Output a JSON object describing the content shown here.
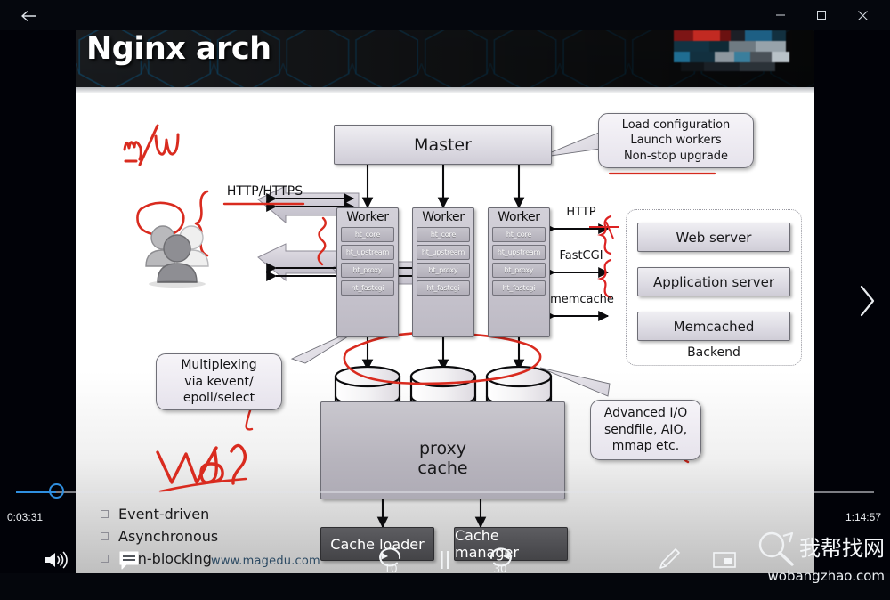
{
  "window": {
    "back_label": "←",
    "minimize_label": "—",
    "maximize_label": "□",
    "close_label": "✕"
  },
  "slide": {
    "title": "Nginx arch",
    "footer_url": "www.magedu.com",
    "master": "Master",
    "master_callout": [
      "Load configuration",
      "Launch workers",
      "Non-stop upgrade"
    ],
    "client_label": "HTTP/HTTPS",
    "workers": [
      {
        "title": "Worker",
        "modules": [
          "ht_core",
          "ht_upstream",
          "ht_proxy",
          "ht_fastcgi"
        ]
      },
      {
        "title": "Worker",
        "modules": [
          "ht_core",
          "ht_upstream",
          "ht_proxy",
          "ht_fastcgi"
        ]
      },
      {
        "title": "Worker",
        "modules": [
          "ht_core",
          "ht_upstream",
          "ht_proxy",
          "ht_fastcgi"
        ]
      }
    ],
    "protocols": [
      "HTTP",
      "FastCGI",
      "memcache"
    ],
    "backend": {
      "title": "Backend",
      "services": [
        "Web server",
        "Application server",
        "Memcached"
      ]
    },
    "multiplexing_callout": [
      "Multiplexing",
      "via kevent/",
      "epoll/select"
    ],
    "advanced_io_callout": [
      "Advanced I/O",
      "sendfile, AIO,",
      "mmap etc."
    ],
    "cache": {
      "label_line1": "proxy",
      "label_line2": "cache",
      "loader": "Cache loader",
      "manager": "Cache manager"
    },
    "bullets": [
      "Event-driven",
      "Asynchronous",
      "Non-blocking"
    ],
    "handwriting": {
      "top_left": "m/w",
      "bottom_left": "Web"
    }
  },
  "player": {
    "time_current": "0:03:31",
    "time_total": "1:14:57",
    "progress_percent": 4.7,
    "back_seconds": "10",
    "forward_seconds": "30",
    "accent_color": "#2f8fe0",
    "icons": {
      "volume": "volume-icon",
      "captions": "captions-icon",
      "rewind": "rewind-10-icon",
      "playpause": "pause-icon",
      "forward": "forward-30-icon",
      "pen": "pen-icon",
      "miniplayer": "mini-player-icon",
      "next": "chevron-right-icon"
    }
  },
  "watermark": {
    "text_cn": "我帮找网",
    "url": "wobangzhao.com"
  }
}
